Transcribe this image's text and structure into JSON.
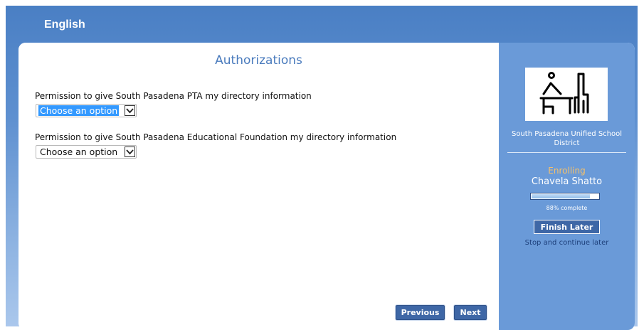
{
  "header": {
    "language": "English"
  },
  "main": {
    "title": "Authorizations",
    "questions": [
      {
        "label": "Permission to give South Pasadena PTA my directory information",
        "selected": "Choose an option"
      },
      {
        "label": "Permission to give South Pasadena Educational Foundation my directory information",
        "selected": "Choose an option"
      }
    ],
    "buttons": {
      "previous": "Previous",
      "next": "Next"
    }
  },
  "sidebar": {
    "district_line1": "South Pasadena Unified School",
    "district_line2": "District",
    "status": "Enrolling",
    "student": "Chavela Shatto",
    "progress_fraction": 0.88,
    "progress_text": "88% complete",
    "finish_label": "Finish Later",
    "stop_text": "Stop and continue later"
  },
  "colors": {
    "header_blue": "#4a7fc4",
    "title_blue": "#4a7bbd",
    "sidebar_blue": "#6a9ad8",
    "button_blue": "#3e67a6",
    "status_orange": "#f5c06a"
  },
  "icons": {
    "logo": "student-at-desk-icon",
    "dropdown": "chevron-down-icon"
  }
}
